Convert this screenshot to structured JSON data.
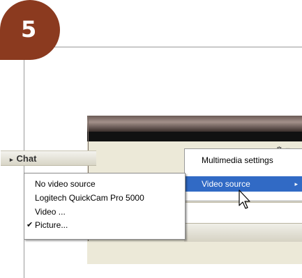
{
  "step": {
    "number": "5"
  },
  "app": {
    "gear_glyph": "⚙",
    "gear_dropdown_glyph": "▾",
    "chat_tab": {
      "label": "Chat",
      "arrow": "▸"
    }
  },
  "context_menu": {
    "items": [
      {
        "label": "Multimedia settings"
      },
      {
        "label": "Video source",
        "highlighted": true,
        "submenu_arrow": "▸"
      }
    ]
  },
  "video_source_submenu": {
    "items": [
      {
        "label": "No video source",
        "checked": false
      },
      {
        "label": "Logitech QuickCam Pro 5000",
        "checked": false
      },
      {
        "label": "Video ...",
        "checked": false
      },
      {
        "label": "Picture...",
        "checked": true,
        "check_glyph": "✔"
      }
    ]
  },
  "colors": {
    "badge": "#8b3a1f",
    "highlight": "#316ac5"
  }
}
